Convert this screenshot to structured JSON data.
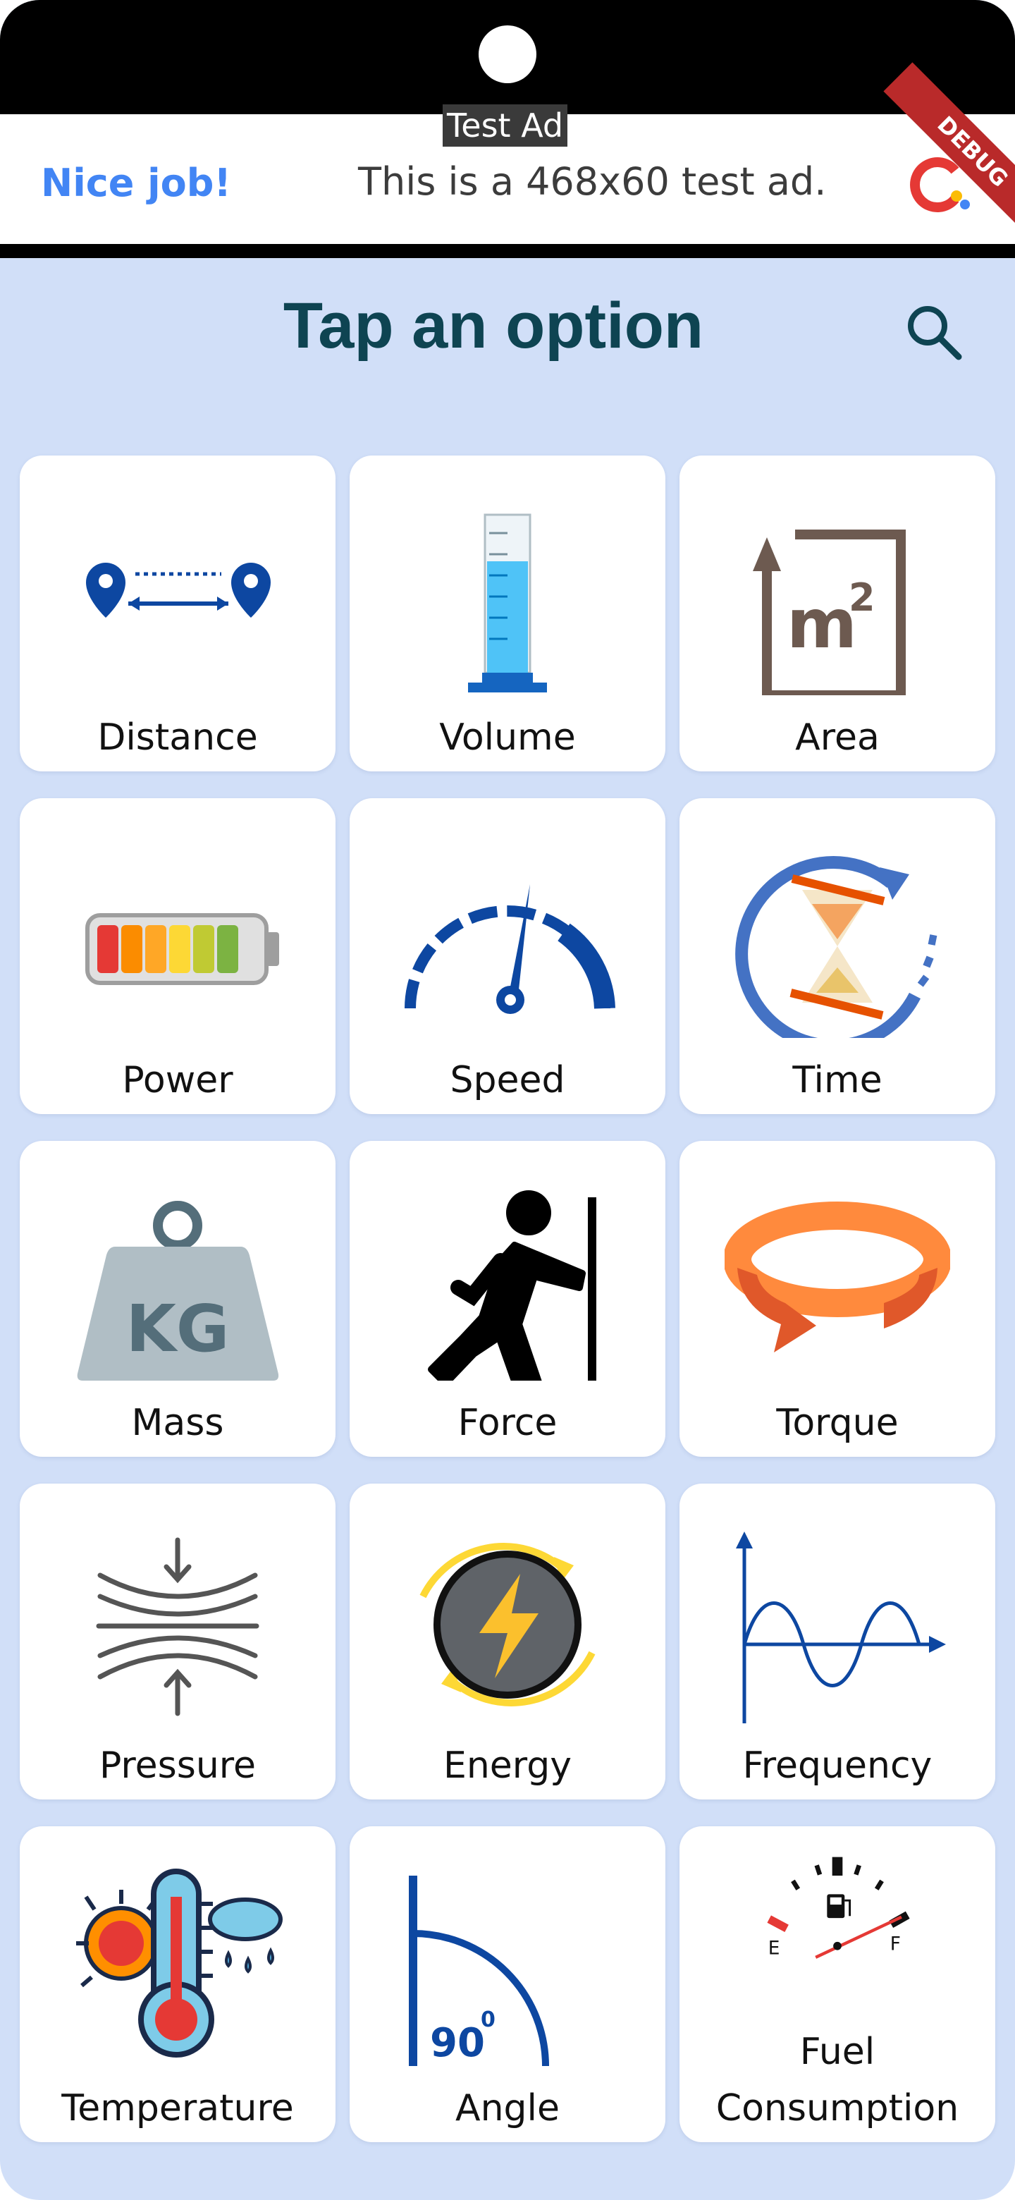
{
  "ad": {
    "tag": "Test Ad",
    "left_text": "Nice job!",
    "main_text": "This is a 468x60 test ad.",
    "ribbon": "DEBUG"
  },
  "header": {
    "title": "Tap an option",
    "search_icon": "search-icon"
  },
  "options": [
    {
      "label": "Distance",
      "icon": "distance-icon"
    },
    {
      "label": "Volume",
      "icon": "volume-icon"
    },
    {
      "label": "Area",
      "icon": "area-icon"
    },
    {
      "label": "Power",
      "icon": "power-icon"
    },
    {
      "label": "Speed",
      "icon": "speed-icon"
    },
    {
      "label": "Time",
      "icon": "time-icon"
    },
    {
      "label": "Mass",
      "icon": "mass-icon"
    },
    {
      "label": "Force",
      "icon": "force-icon"
    },
    {
      "label": "Torque",
      "icon": "torque-icon"
    },
    {
      "label": "Pressure",
      "icon": "pressure-icon"
    },
    {
      "label": "Energy",
      "icon": "energy-icon"
    },
    {
      "label": "Frequency",
      "icon": "frequency-icon"
    },
    {
      "label": "Temperature",
      "icon": "temperature-icon"
    },
    {
      "label": "Angle",
      "icon": "angle-icon"
    },
    {
      "label": "Fuel Consumption",
      "label_line1": "Fuel",
      "label_line2": "Consumption",
      "icon": "fuel-icon"
    }
  ],
  "icon_text": {
    "area_unit": "m",
    "area_exp": "2",
    "mass_unit": "KG",
    "angle_value": "90",
    "angle_deg": "0",
    "fuel_empty": "E",
    "fuel_full": "F"
  },
  "colors": {
    "background": "#d1dff8",
    "title": "#0e4452",
    "ad_link": "#4285f4",
    "debug_ribbon": "#b92a2a"
  }
}
